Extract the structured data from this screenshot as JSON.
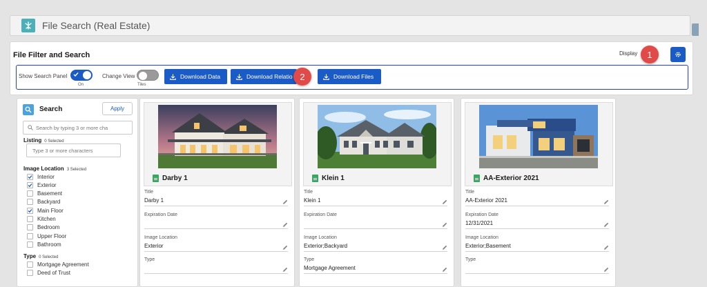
{
  "app": {
    "title": "File Search (Real Estate)"
  },
  "filter_panel": {
    "title": "File Filter and Search",
    "display_label": "Display",
    "display_tail": "s",
    "controls": {
      "show_search_panel": {
        "label": "Show Search Panel",
        "state": "On"
      },
      "change_view": {
        "label": "Change View",
        "state": "Tiles"
      }
    },
    "buttons": {
      "download_data": "Download Data",
      "download_relations": "Download Relatio",
      "download_files": "Download Files"
    }
  },
  "callouts": {
    "one": "1",
    "two": "2"
  },
  "search_panel": {
    "title": "Search",
    "apply_label": "Apply",
    "search_placeholder": "Search by typing 3 or more cha",
    "listing": {
      "label": "Listing",
      "selected": "0 Selected",
      "placeholder": "Type 3 or more characters"
    },
    "image_location": {
      "label": "Image Location",
      "selected": "3 Selected",
      "options": [
        {
          "label": "Interior",
          "checked": true
        },
        {
          "label": "Exterior",
          "checked": true
        },
        {
          "label": "Basement",
          "checked": false
        },
        {
          "label": "Backyard",
          "checked": false
        },
        {
          "label": "Main Floor",
          "checked": true
        },
        {
          "label": "Kitchen",
          "checked": false
        },
        {
          "label": "Bedroom",
          "checked": false
        },
        {
          "label": "Upper Floor",
          "checked": false
        },
        {
          "label": "Bathroom",
          "checked": false
        }
      ]
    },
    "type": {
      "label": "Type",
      "selected": "0 Selected",
      "options": [
        {
          "label": "Mortgage Agreement",
          "checked": false
        },
        {
          "label": "Deed of Trust",
          "checked": false
        }
      ]
    }
  },
  "field_labels": {
    "title": "Title",
    "expiration": "Expiration Date",
    "location": "Image Location",
    "type": "Type"
  },
  "cards": [
    {
      "name": "Darby 1",
      "title": "Darby 1",
      "expiration": "",
      "location": "Exterior",
      "type": ""
    },
    {
      "name": "Klein 1",
      "title": "Klein 1",
      "expiration": "",
      "location": "Exterior;Backyard",
      "type": "Mortgage Agreement"
    },
    {
      "name": "AA-Exterior 2021",
      "title": "AA-Exterior 2021",
      "expiration": "12/31/2021",
      "location": "Exterior;Basement",
      "type": ""
    }
  ],
  "colors": {
    "brand_blue": "#1b5bc6",
    "callout_red": "#e04b49",
    "app_teal": "#4bb0b8",
    "doc_green": "#37a85e"
  }
}
